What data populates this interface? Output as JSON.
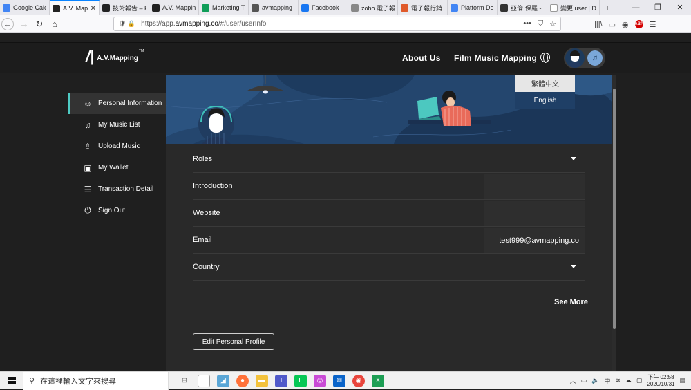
{
  "browser": {
    "tabs": [
      {
        "title": "Google Cale",
        "color": "#4285f4",
        "active": false
      },
      {
        "title": "A.V. Map",
        "color": "#222222",
        "active": true
      },
      {
        "title": "技術報告 – F",
        "color": "#222222",
        "active": false
      },
      {
        "title": "A.V. Mappin",
        "color": "#222222",
        "active": false
      },
      {
        "title": "Marketing T",
        "color": "#0f9d58",
        "active": false
      },
      {
        "title": "avmapping",
        "color": "#555555",
        "active": false
      },
      {
        "title": "Facebook",
        "color": "#1877f2",
        "active": false
      },
      {
        "title": "zoho 電子報",
        "color": "#888888",
        "active": false
      },
      {
        "title": "電子報行銷",
        "color": "#e05a2b",
        "active": false
      },
      {
        "title": "Platform De",
        "color": "#4285f4",
        "active": false
      },
      {
        "title": "亞倫·保羅 -",
        "color": "#333333",
        "active": false
      },
      {
        "title": "變更 user | Djang",
        "color": "#ffffff",
        "active": false
      }
    ],
    "url_prefix": "https://app.",
    "url_domain": "avmapping.co",
    "url_path": "/#/user/userInfo"
  },
  "header": {
    "logo_mark": "/̅",
    "logo_name": "A.V.Mapping",
    "logo_tm": "TM",
    "nav": [
      "About Us",
      "Film Music Mapping"
    ],
    "music_icon": "♫"
  },
  "language_menu": {
    "options": [
      "繁體中文",
      "English"
    ]
  },
  "sidebar": {
    "items": [
      {
        "label": "Personal Information",
        "icon": "person-icon",
        "glyph": "☺",
        "active": true
      },
      {
        "label": "My Music List",
        "icon": "music-note-icon",
        "glyph": "♫",
        "active": false
      },
      {
        "label": "Upload Music",
        "icon": "upload-icon",
        "glyph": "⇪",
        "active": false
      },
      {
        "label": "My Wallet",
        "icon": "wallet-icon",
        "glyph": "▣",
        "active": false
      },
      {
        "label": "Transaction Detail",
        "icon": "list-icon",
        "glyph": "☰",
        "active": false
      },
      {
        "label": "Sign Out",
        "icon": "power-icon",
        "glyph": "⏻",
        "active": false
      }
    ]
  },
  "profile": {
    "fields": [
      {
        "label": "Roles",
        "value": "",
        "dropdown": true
      },
      {
        "label": "Introduction",
        "value": "",
        "dropdown": false
      },
      {
        "label": "Website",
        "value": "",
        "dropdown": false
      },
      {
        "label": "Email",
        "value": "test999@avmapping.co",
        "dropdown": false
      },
      {
        "label": "Country",
        "value": "",
        "dropdown": true
      }
    ],
    "see_more": "See More",
    "edit_button": "Edit Personal Profile"
  },
  "taskbar": {
    "search_placeholder": "在這裡輸入文字來搜尋",
    "time": "下午 02:58",
    "date": "2020/10/31",
    "tray_lang": "中"
  }
}
